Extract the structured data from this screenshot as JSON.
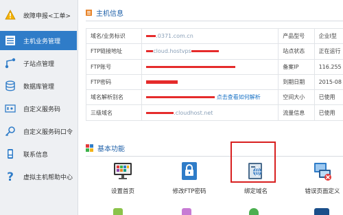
{
  "sidebar": {
    "items": [
      {
        "label": "故障申报<工单>",
        "icon": "warning-icon",
        "active": false
      },
      {
        "label": "主机业务管理",
        "icon": "host-list-icon",
        "active": true
      },
      {
        "label": "子站点管理",
        "icon": "subsite-icon",
        "active": false
      },
      {
        "label": "数据库管理",
        "icon": "database-icon",
        "active": false
      },
      {
        "label": "自定义服务码",
        "icon": "service-code-icon",
        "active": false
      },
      {
        "label": "自定义服务码口令",
        "icon": "key-icon",
        "active": false
      },
      {
        "label": "联系信息",
        "icon": "phone-icon",
        "active": false
      },
      {
        "label": "虚拟主机帮助中心",
        "icon": "help-icon",
        "active": false
      }
    ]
  },
  "host_info": {
    "title": "主机信息",
    "rows": [
      {
        "k1": "域名/业务标识",
        "v1": ".0371.com.cn",
        "k2": "产品型号",
        "v2": "企业I型"
      },
      {
        "k1": "FTP链接地址",
        "v1": "cloud.hostvps",
        "k2": "站点状态",
        "v2": "正在运行"
      },
      {
        "k1": "FTP账号",
        "v1": "",
        "k2": "备案IP",
        "v2": "116.255"
      },
      {
        "k1": "FTP密码",
        "v1": "",
        "k2": "到期日期",
        "v2": "2015-08"
      },
      {
        "k1": "域名解析别名",
        "v1": "",
        "v1_link": "点击查看如何解析",
        "k2": "空间大小",
        "v2": "已使用"
      },
      {
        "k1": "三级域名",
        "v1": ".cloudhost.net",
        "k2": "流量信息",
        "v2": "已使用"
      }
    ]
  },
  "basic": {
    "title": "基本功能",
    "features": [
      {
        "label": "设置首页",
        "icon": "homepage-monitor-icon"
      },
      {
        "label": "修改FTP密码",
        "icon": "lock-icon"
      },
      {
        "label": "绑定域名",
        "icon": "bind-domain-icon"
      },
      {
        "label": "错误页面定义",
        "icon": "error-page-icon"
      }
    ]
  },
  "colors": {
    "accent": "#2f7cc8",
    "highlight": "#d81f1f",
    "redaction": "#e52b2b",
    "link": "#1a73c6"
  }
}
